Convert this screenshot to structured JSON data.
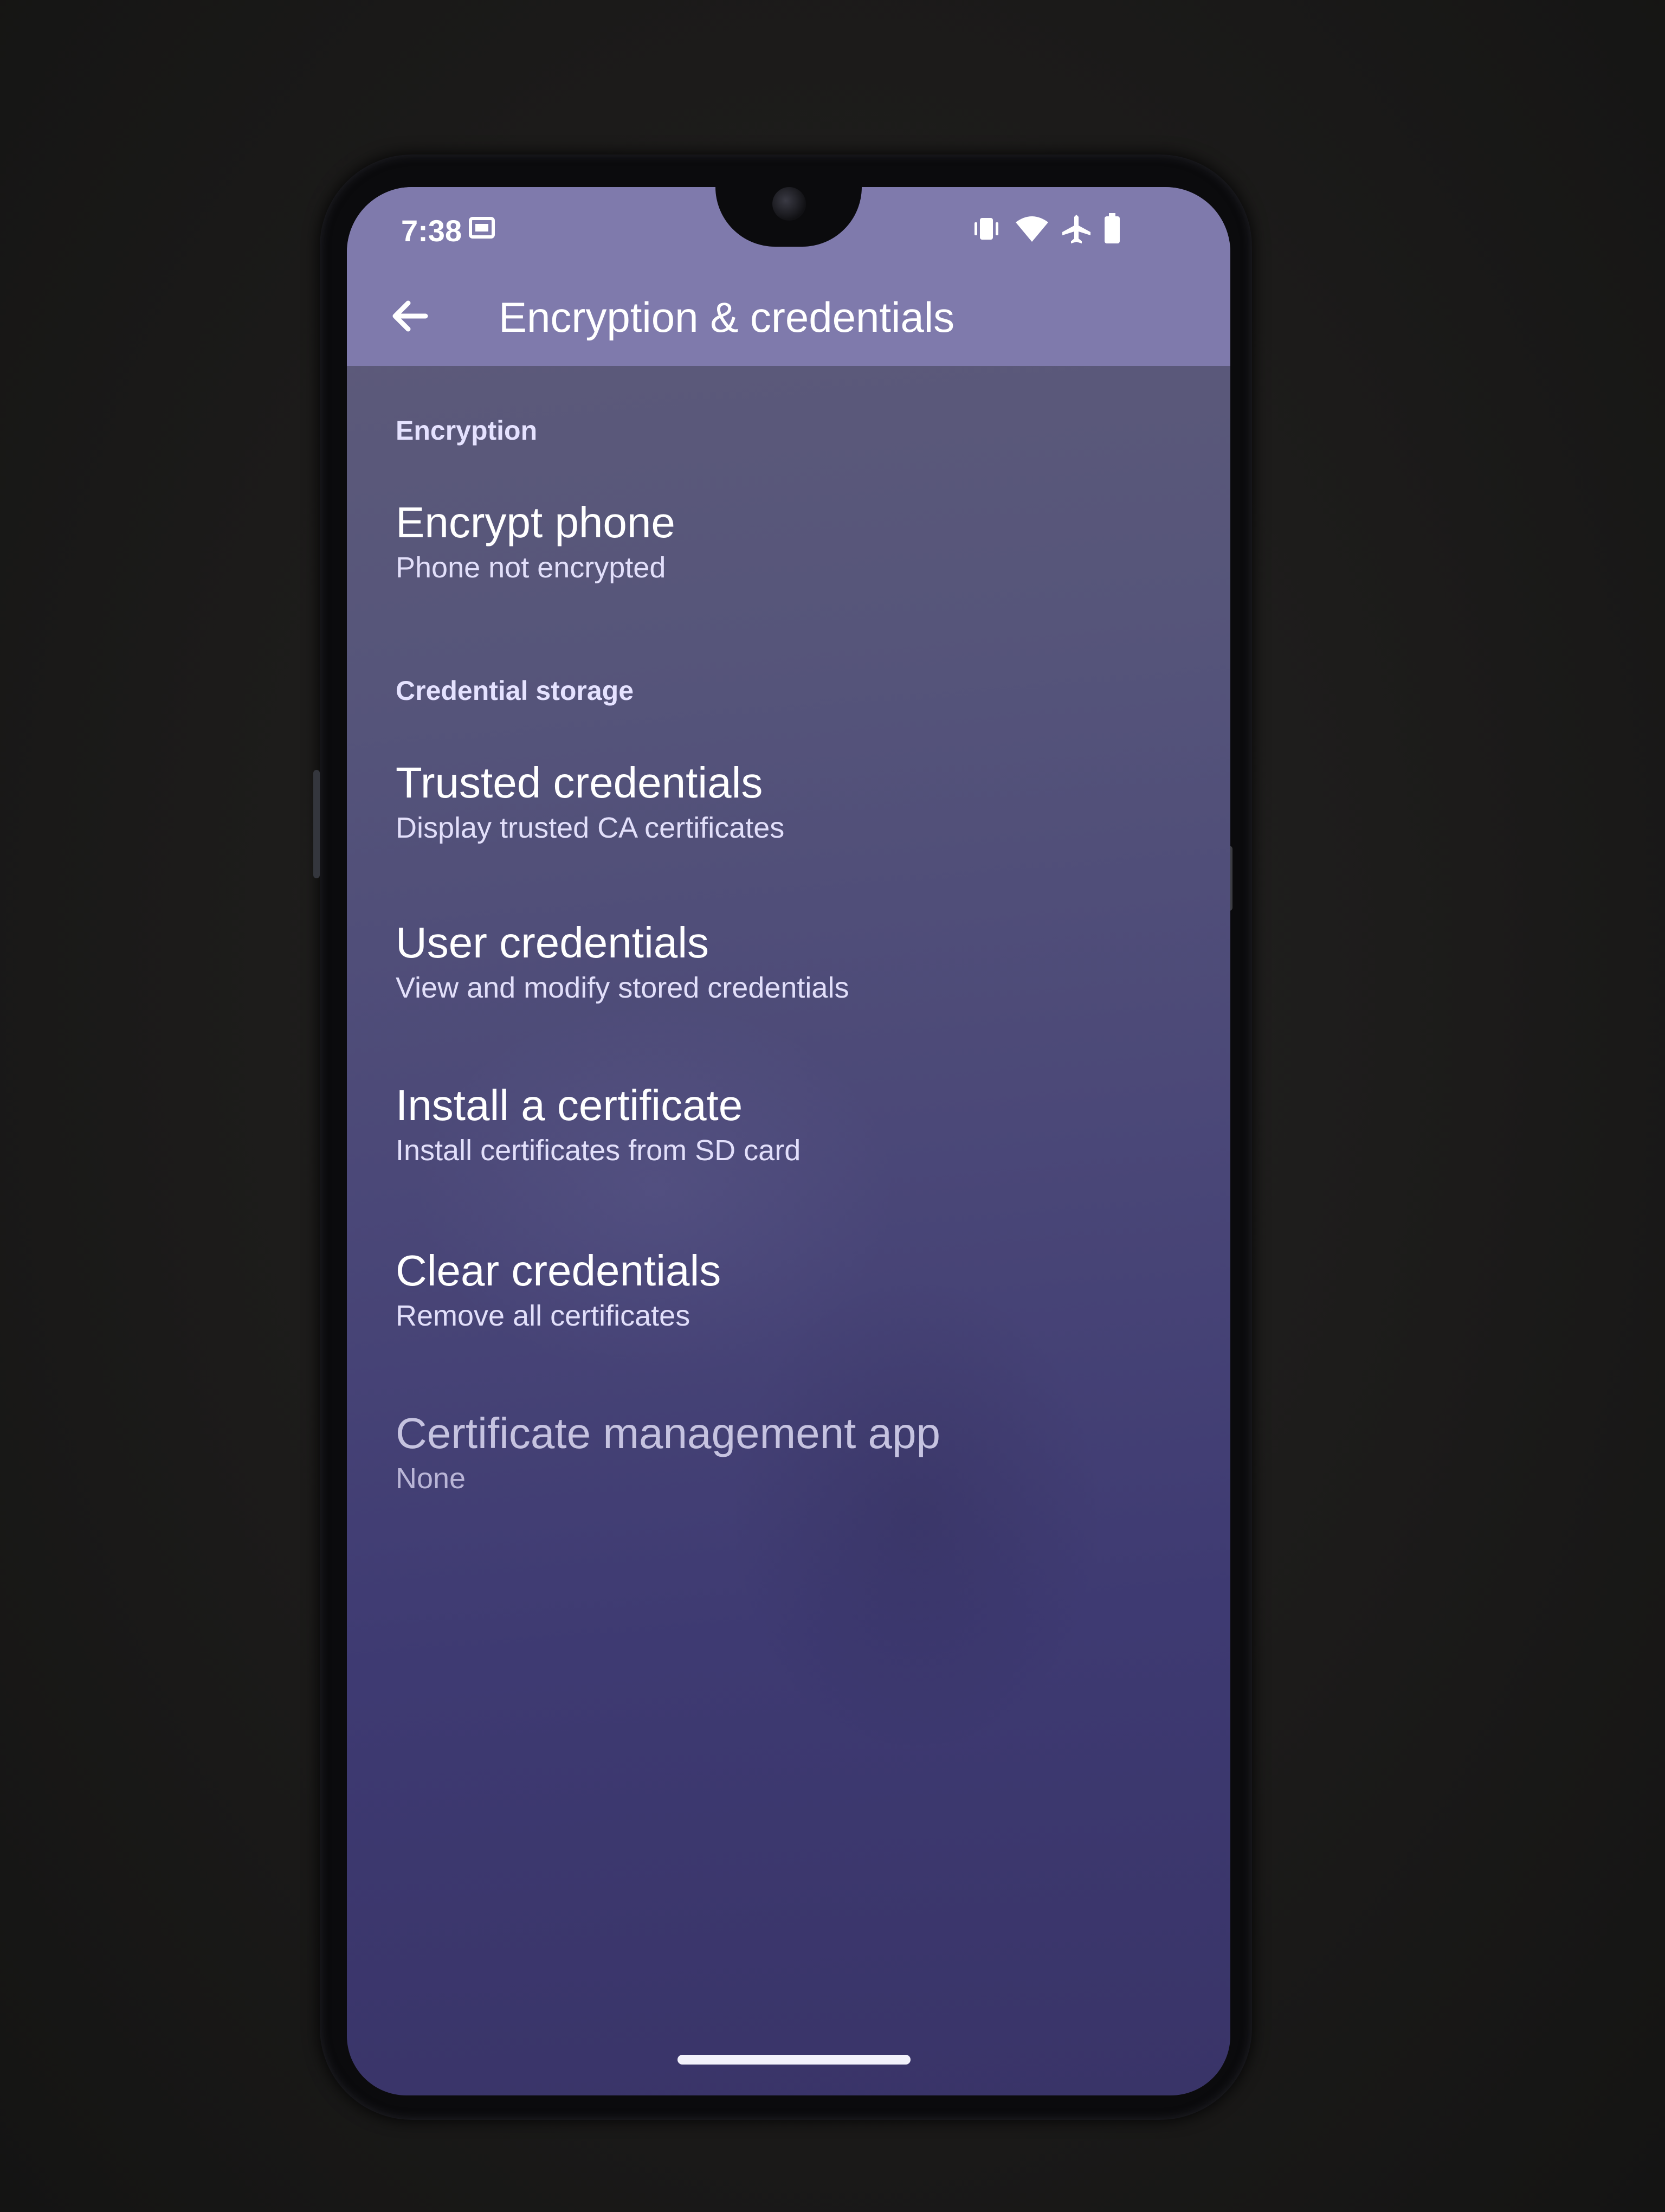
{
  "status_bar": {
    "time": "7:38",
    "icons": [
      "screenshot-notification-icon",
      "vibrate-icon",
      "wifi-icon",
      "airplane-mode-icon",
      "battery-icon"
    ]
  },
  "app_bar": {
    "title": "Encryption & credentials",
    "back_icon": "arrow-back-icon"
  },
  "sections": [
    {
      "header": "Encryption",
      "items": [
        {
          "title": "Encrypt phone",
          "summary": "Phone not encrypted",
          "enabled": true
        }
      ]
    },
    {
      "header": "Credential storage",
      "items": [
        {
          "title": "Trusted credentials",
          "summary": "Display trusted CA certificates",
          "enabled": true
        },
        {
          "title": "User credentials",
          "summary": "View and modify stored credentials",
          "enabled": true
        },
        {
          "title": "Install a certificate",
          "summary": "Install certificates from SD card",
          "enabled": true
        },
        {
          "title": "Clear credentials",
          "summary": "Remove all certificates",
          "enabled": true
        },
        {
          "title": "Certificate management app",
          "summary": "None",
          "enabled": false
        }
      ]
    }
  ],
  "colors": {
    "app_bar": "#7f7aac",
    "screen_background": "#4b4878",
    "section_header": "#e5e2ff",
    "text_primary": "#ffffff"
  }
}
